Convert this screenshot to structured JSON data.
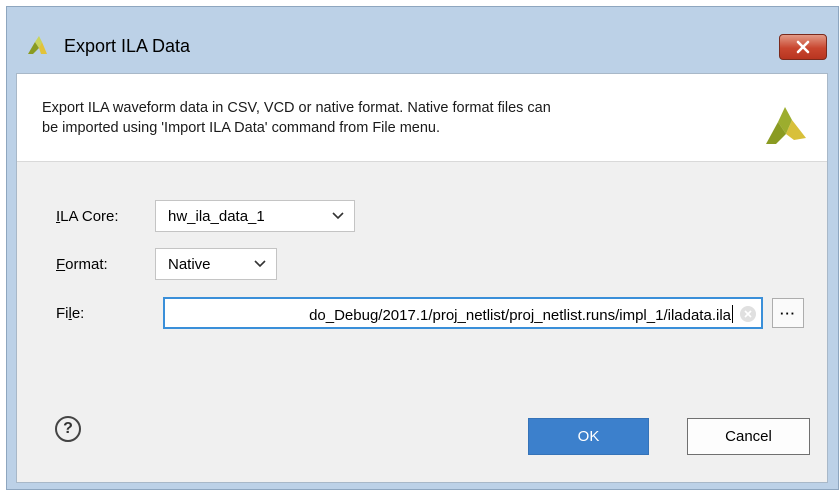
{
  "window": {
    "title": "Export ILA Data",
    "close_label": "x"
  },
  "header": {
    "description_line1": "Export ILA waveform data in CSV, VCD or native format. Native format files can",
    "description_line2": "be imported using 'Import ILA Data' command from File menu."
  },
  "form": {
    "ila_core": {
      "label_mnemonic": "I",
      "label_rest": "LA Core:",
      "value": "hw_ila_data_1"
    },
    "format": {
      "label_mnemonic": "F",
      "label_rest": "ormat:",
      "value": "Native"
    },
    "file": {
      "label_pre": "Fi",
      "label_mnemonic": "l",
      "label_rest": "e:",
      "value": "do_Debug/2017.1/proj_netlist/proj_netlist.runs/impl_1/iladata.ila"
    },
    "browse_label": "···"
  },
  "footer": {
    "help_label": "?",
    "ok_label": "OK",
    "cancel_label": "Cancel"
  },
  "colors": {
    "accent": "#3c80cc",
    "logo": "#9cad2e",
    "close": "#c9462f"
  },
  "icons": [
    "app-logo-icon",
    "close-icon",
    "chevron-down-icon",
    "clear-icon",
    "help-icon"
  ]
}
